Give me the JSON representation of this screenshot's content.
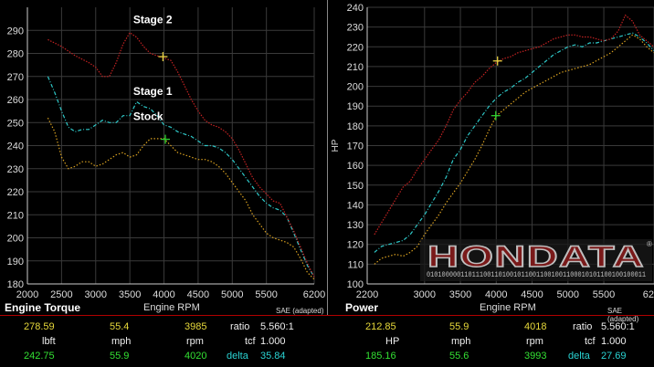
{
  "colors": {
    "stage2": "#c22222",
    "stage1": "#2ec8c8",
    "stock": "#d8a020",
    "grid": "#3a3a3a",
    "axis": "#cccccc",
    "marker_yellow": "#e8d040",
    "marker_green": "#30d030"
  },
  "chart_data": [
    {
      "type": "line",
      "title": "Engine Torque",
      "xlabel": "Engine RPM",
      "ylabel": "",
      "note": "SAE (adapted)",
      "xlim": [
        2000,
        6200
      ],
      "ylim": [
        180,
        300
      ],
      "xticks": [
        2000,
        2500,
        3000,
        3500,
        4000,
        4500,
        5000,
        5500,
        6200
      ],
      "yticks": [
        180,
        190,
        200,
        210,
        220,
        230,
        240,
        250,
        260,
        270,
        280,
        290
      ],
      "series": [
        {
          "name": "Stage 2",
          "key": "stage2",
          "x": [
            2300,
            2500,
            2700,
            2900,
            3000,
            3100,
            3200,
            3300,
            3400,
            3500,
            3600,
            3700,
            3800,
            3900,
            4000,
            4100,
            4200,
            4300,
            4400,
            4500,
            4600,
            4700,
            4800,
            4900,
            5000,
            5100,
            5200,
            5300,
            5400,
            5500,
            5600,
            5700,
            5800,
            5900,
            6000,
            6100,
            6200
          ],
          "y": [
            286,
            283,
            279,
            276,
            274,
            270,
            270,
            276,
            284,
            289,
            287,
            283,
            280,
            279,
            278,
            277,
            272,
            266,
            260,
            255,
            251,
            249,
            248,
            246,
            243,
            238,
            232,
            226,
            222,
            219,
            216,
            215,
            209,
            203,
            196,
            189,
            183
          ]
        },
        {
          "name": "Stage 1",
          "key": "stage1",
          "x": [
            2300,
            2400,
            2500,
            2600,
            2700,
            2800,
            2900,
            3000,
            3100,
            3200,
            3300,
            3400,
            3500,
            3600,
            3700,
            3800,
            3900,
            4000,
            4100,
            4200,
            4300,
            4400,
            4500,
            4600,
            4700,
            4800,
            4900,
            5000,
            5100,
            5200,
            5300,
            5400,
            5500,
            5600,
            5700,
            5800,
            5900,
            6000,
            6100,
            6200
          ],
          "y": [
            270,
            263,
            255,
            248,
            246,
            247,
            247,
            249,
            251,
            250,
            250,
            253,
            253,
            259,
            257,
            256,
            253,
            249,
            248,
            246,
            245,
            244,
            242,
            240,
            240,
            239,
            237,
            234,
            230,
            226,
            222,
            218,
            215,
            213,
            212,
            209,
            202,
            195,
            188,
            183
          ]
        },
        {
          "name": "Stock",
          "key": "stock",
          "x": [
            2300,
            2400,
            2500,
            2600,
            2700,
            2800,
            2900,
            3000,
            3100,
            3200,
            3300,
            3400,
            3500,
            3600,
            3700,
            3800,
            3900,
            4000,
            4100,
            4200,
            4300,
            4400,
            4500,
            4600,
            4700,
            4800,
            4900,
            5000,
            5100,
            5200,
            5300,
            5400,
            5500,
            5600,
            5700,
            5800,
            5900,
            6000,
            6100,
            6200
          ],
          "y": [
            252,
            246,
            235,
            230,
            231,
            233,
            233,
            231,
            232,
            234,
            236,
            237,
            235,
            236,
            240,
            243,
            243,
            243,
            240,
            237,
            236,
            235,
            234,
            234,
            233,
            231,
            228,
            224,
            220,
            216,
            210,
            206,
            202,
            200,
            199,
            198,
            196,
            191,
            185,
            182
          ]
        }
      ],
      "markers": [
        {
          "x": 3985,
          "y": 278.59,
          "color": "yellow"
        },
        {
          "x": 4020,
          "y": 242.75,
          "color": "green"
        }
      ],
      "annotations": [
        {
          "text": "Stage 2",
          "x": 3550,
          "y": 293
        },
        {
          "text": "Stage 1",
          "x": 3550,
          "y": 262
        },
        {
          "text": "Stock",
          "x": 3550,
          "y": 251
        }
      ]
    },
    {
      "type": "line",
      "title": "Power",
      "xlabel": "Engine RPM",
      "ylabel": "HP",
      "note": "SAE (adapted)",
      "xlim": [
        2200,
        6200
      ],
      "ylim": [
        100,
        240
      ],
      "xticks": [
        2200,
        3000,
        3500,
        4000,
        4500,
        5000,
        5500,
        6200
      ],
      "yticks": [
        100,
        110,
        120,
        130,
        140,
        150,
        160,
        170,
        180,
        190,
        200,
        210,
        220,
        230,
        240
      ],
      "series": [
        {
          "name": "Stage 2",
          "key": "stage2",
          "x": [
            2300,
            2400,
            2500,
            2600,
            2700,
            2800,
            2900,
            3000,
            3100,
            3200,
            3300,
            3400,
            3500,
            3600,
            3700,
            3800,
            3900,
            4000,
            4100,
            4200,
            4300,
            4400,
            4500,
            4600,
            4700,
            4800,
            4900,
            5000,
            5100,
            5200,
            5300,
            5400,
            5500,
            5600,
            5700,
            5800,
            5900,
            6000,
            6100,
            6200
          ],
          "y": [
            125,
            131,
            137,
            143,
            149,
            152,
            158,
            163,
            168,
            173,
            180,
            188,
            193,
            197,
            202,
            205,
            209,
            212,
            214,
            215,
            217,
            218,
            219,
            220,
            222,
            224,
            225,
            226,
            226,
            225,
            225,
            224,
            223,
            224,
            228,
            236,
            233,
            226,
            223,
            220
          ]
        },
        {
          "name": "Stage 1",
          "key": "stage1",
          "x": [
            2300,
            2400,
            2500,
            2600,
            2700,
            2800,
            2900,
            3000,
            3100,
            3200,
            3300,
            3400,
            3500,
            3600,
            3700,
            3800,
            3900,
            4000,
            4100,
            4200,
            4300,
            4400,
            4500,
            4600,
            4700,
            4800,
            4900,
            5000,
            5100,
            5200,
            5300,
            5400,
            5500,
            5600,
            5700,
            5800,
            5900,
            6000,
            6100,
            6200
          ],
          "y": [
            116,
            119,
            120,
            121,
            122,
            125,
            130,
            135,
            141,
            147,
            154,
            163,
            168,
            175,
            180,
            185,
            190,
            194,
            197,
            199,
            202,
            204,
            207,
            210,
            213,
            216,
            218,
            220,
            221,
            220,
            222,
            222,
            223,
            224,
            225,
            226,
            227,
            225,
            222,
            218
          ]
        },
        {
          "name": "Stock",
          "key": "stock",
          "x": [
            2300,
            2400,
            2500,
            2600,
            2700,
            2800,
            2900,
            3000,
            3100,
            3200,
            3300,
            3400,
            3500,
            3600,
            3700,
            3800,
            3900,
            4000,
            4100,
            4200,
            4300,
            4400,
            4500,
            4600,
            4700,
            4800,
            4900,
            5000,
            5100,
            5200,
            5300,
            5400,
            5500,
            5600,
            5700,
            5800,
            5900,
            6000,
            6100,
            6200
          ],
          "y": [
            110,
            113,
            114,
            115,
            114,
            116,
            119,
            125,
            130,
            135,
            141,
            146,
            151,
            157,
            163,
            170,
            178,
            185,
            188,
            191,
            194,
            197,
            199,
            201,
            203,
            205,
            207,
            208,
            209,
            210,
            211,
            213,
            215,
            217,
            220,
            223,
            226,
            224,
            220,
            217
          ]
        }
      ],
      "markers": [
        {
          "x": 4018,
          "y": 212.85,
          "color": "yellow"
        },
        {
          "x": 3993,
          "y": 185.16,
          "color": "green"
        }
      ]
    }
  ],
  "logo": {
    "text": "HONDATA",
    "binary": "0101000001101110011010010110011001001100010101100100100011"
  },
  "left_panel": {
    "title": "Engine Torque",
    "xlabel": "Engine RPM",
    "note": "SAE (adapted)",
    "row1": {
      "value": "278.59",
      "speed": "55.4",
      "rpm": "3985",
      "ratio_label": "ratio",
      "ratio": "5.560:1"
    },
    "row2": {
      "unit": "lbft",
      "speed_unit": "mph",
      "rpm_unit": "rpm",
      "tcf_label": "tcf",
      "tcf": "1.000"
    },
    "row3": {
      "value": "242.75",
      "speed": "55.9",
      "rpm": "4020",
      "delta_label": "delta",
      "delta": "35.84"
    }
  },
  "right_panel": {
    "title": "Power",
    "xlabel": "Engine RPM",
    "note": "SAE (adapted)",
    "row1": {
      "value": "212.85",
      "speed": "55.9",
      "rpm": "4018",
      "ratio_label": "ratio",
      "ratio": "5.560:1"
    },
    "row2": {
      "unit": "HP",
      "speed_unit": "mph",
      "rpm_unit": "rpm",
      "tcf_label": "tcf",
      "tcf": "1.000"
    },
    "row3": {
      "value": "185.16",
      "speed": "55.6",
      "rpm": "3993",
      "delta_label": "delta",
      "delta": "27.69"
    }
  }
}
